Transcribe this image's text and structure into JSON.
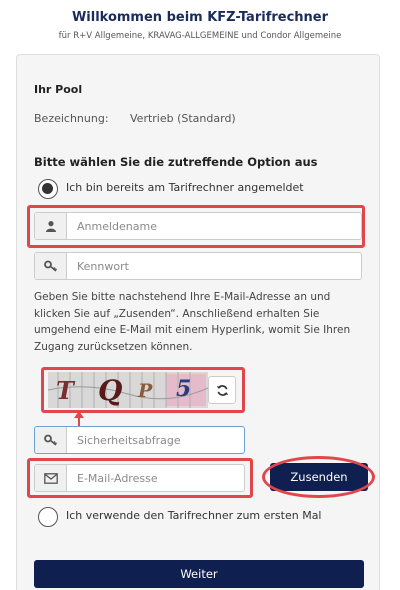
{
  "header": {
    "title": "Willkommen beim KFZ-Tarifrechner",
    "subtitle": "für R+V Allgemeine, KRAVAG-ALLGEMEINE und Condor Allgemeine"
  },
  "pool": {
    "heading": "Ihr Pool",
    "designation_label": "Bezeichnung:",
    "designation_value": "Vertrieb (Standard)"
  },
  "options": {
    "heading": "Bitte wählen Sie die zutreffende Option aus",
    "registered_label": "Ich bin bereits am Tarifrechner angemeldet",
    "first_time_label": "Ich verwende den Tarifrechner zum ersten Mal",
    "selected": "registered"
  },
  "login": {
    "username_placeholder": "Anmeldename",
    "password_placeholder": "Kennwort"
  },
  "reset": {
    "info_text": "Geben Sie bitte nachstehend Ihre E-Mail-Adresse an und klicken Sie auf „Zusenden“. Anschließend erhalten Sie umgehend eine E-Mail mit einem Hyperlink, womit Sie Ihren Zugang zurücksetzen können.",
    "captcha_chars": [
      "T",
      "Q",
      "P",
      "5"
    ],
    "security_placeholder": "Sicherheitsabfrage",
    "email_placeholder": "E-Mail-Adresse",
    "send_label": "Zusenden"
  },
  "footer": {
    "continue_label": "Weiter"
  },
  "colors": {
    "primary": "#0f1f4f",
    "highlight": "#e0474c",
    "title": "#1a2b5c"
  },
  "icons": {
    "username": "user-icon",
    "password": "key-icon",
    "security": "key-icon",
    "email": "envelope-icon",
    "refresh": "refresh-icon"
  }
}
